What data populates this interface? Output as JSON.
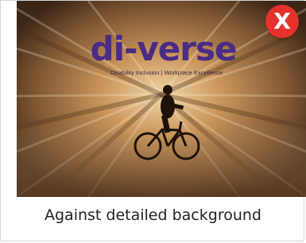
{
  "photo": {
    "description_icon": "cyclist-photo",
    "logo": {
      "text": "di-verse",
      "color": "#4a2b85",
      "tagline": "Disability Inclusion | Workplace Excellence"
    }
  },
  "close_button": {
    "label": "X",
    "icon": "close-icon",
    "color": "#e5322d"
  },
  "caption": {
    "text": "Against detailed background"
  }
}
